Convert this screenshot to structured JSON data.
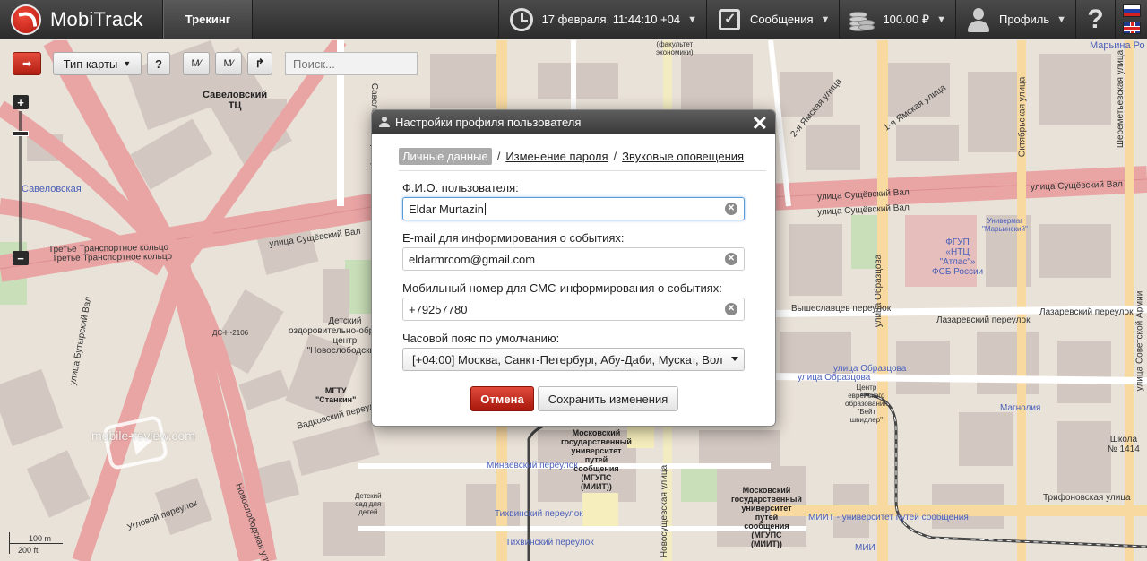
{
  "app": {
    "name": "MobiTrack",
    "active_tab": "Трекинг"
  },
  "topbar": {
    "datetime": "17 февраля, 11:44:10 +04",
    "messages_label": "Сообщения",
    "balance": "100.00 ₽",
    "profile_label": "Профиль",
    "help_label": "?"
  },
  "map_toolbar": {
    "map_type_label": "Тип карты",
    "help_label": "?",
    "search_placeholder": "Поиск..."
  },
  "map": {
    "scale_m": "100 m",
    "scale_ft": "200 ft",
    "watermark": "mobile-review.com",
    "labels": {
      "savelovsky_tc": "Савеловский\nТЦ",
      "savelovskaya": "Савеловская",
      "third_ring_1": "Третье Транспортное кольцо",
      "third_ring_2": "Третье Транспортное кольцо",
      "sushchevsky_val_left": "улица Сущёвский Вал",
      "sushchevsky_val_1": "улица Сущёвский Вал",
      "sushchevsky_val_2": "улица Сущёвский Вал",
      "sushchevsky_val_3": "улица Сущёвский Вал",
      "butyrsky_val": "улица Бутырский Вал",
      "vadkovsky": "Вадковский переулок",
      "ugolny": "Угловой переулок",
      "novoslobodskaya": "Новослободская улица",
      "detsky_center": "Детский\nоздоровительно-образоват\nцентр\n\"Новослободский\"",
      "stankin": "МГТУ\n\"Станкин\"",
      "detsky_sad": "Детский\nсад для\nдетей",
      "miit_1": "Московский\nгосударственный\nуниверситет\nпутей\nсообщения\n(МГУПС\n(МИИТ))",
      "miit_2": "Московский\nгосударственный\nуниверситет\nпутей\nсообщения\n(МГУПС\n(МИИТ))",
      "minaevsky": "Минаевский переулок",
      "tikhvinsky_1": "Тихвинский переулок",
      "tikhvinsky_2": "Тихвинский переулок",
      "novosushchevskaya": "Новосущевская улица",
      "obraztsova_1": "улица Образцова",
      "obraztsova_2": "улица Образцова",
      "obraztsova_vert": "улица Образцова",
      "vysheslavtsev": "Вышеславцев переулок",
      "lazarevsky_1": "Лазаревский переулок",
      "lazarevsky_2": "Лазаревский переулок",
      "fgup": "ФГУП\n«НТЦ\n\"Атлас\"»\nФСБ России",
      "marinsky": "Универмаг\n\"Марьинский\"",
      "marina_roscha": "Марьина Ро",
      "sheremetevskaya": "Шереметьевская улица",
      "oktyabrskaya": "Октябрьская улица",
      "sovetskoy_armii": "улица Советской Армии",
      "evrejsky": "Центр\nеврейского\nобразования\n\"Бейт\nшвидлер\"",
      "magnoliya": "Магнолия",
      "shkola": "Школа\n№ 1414",
      "trifonovskaya": "Трифоновская улица",
      "miit_street": "МИИТ - университет путей сообщения",
      "yamskaya_1": "1-я Ямская улица",
      "yamskaya_2": "2-я Ямская улица",
      "savelovsky_proezd": "Савеловский проезд",
      "dks": "ДС-Н-2106",
      "fakultet": "(факультет\nэкономики)",
      "mia": "МИИ"
    }
  },
  "modal": {
    "title": "Настройки профиля пользователя",
    "tabs": [
      "Личные данные",
      "Изменение пароля",
      "Звуковые оповещения"
    ],
    "fields": {
      "name_label": "Ф.И.О. пользователя:",
      "name_value": "Eldar Murtazin",
      "email_label": "E-mail для информирования о событиях:",
      "email_value": "eldarmrcom@gmail.com",
      "phone_label": "Мобильный номер для СМС-информирования о событиях:",
      "phone_value": "+79257780",
      "tz_label": "Часовой пояс по умолчанию:",
      "tz_value": "[+04:00] Москва, Санкт-Петербург, Абу-Даби, Мускат, Вол"
    },
    "cancel_label": "Отмена",
    "save_label": "Сохранить изменения"
  },
  "colors": {
    "topbar": "#3a3a3a",
    "accent_red": "#c0281a",
    "road_major": "#e9a4a4",
    "building": "#d3c7c1",
    "park": "#c9dfb9",
    "map_bg": "#e9e2d8",
    "primary_road": "#f8d9a0"
  }
}
